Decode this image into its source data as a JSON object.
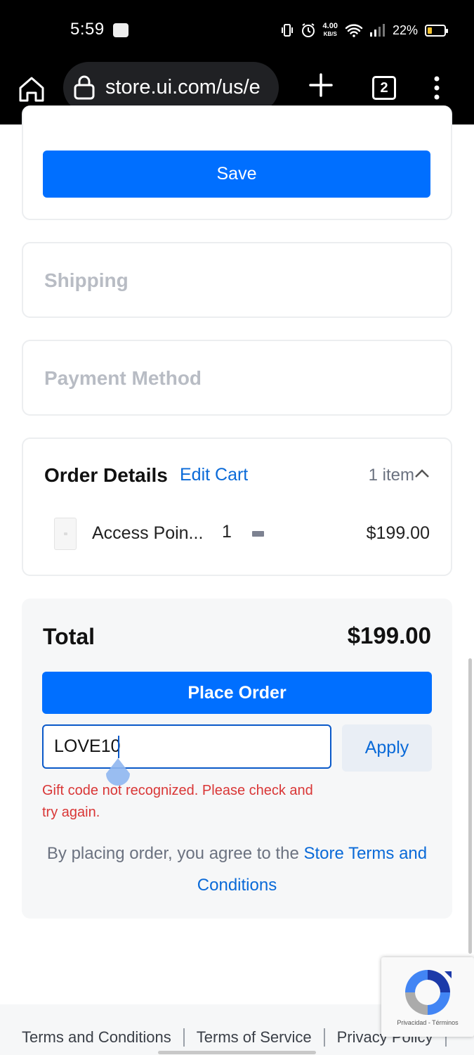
{
  "status_bar": {
    "time": "5:59",
    "net_speed_value": "4.00",
    "net_speed_unit": "KB/S",
    "battery": "22%"
  },
  "browser": {
    "url": "store.ui.com/us/e",
    "tab_count": "2"
  },
  "address_card": {
    "save_label": "Save"
  },
  "sections": {
    "shipping": "Shipping",
    "payment": "Payment Method"
  },
  "order_details": {
    "title": "Order Details",
    "edit_cart": "Edit Cart",
    "item_count": "1 item",
    "items": [
      {
        "name": "Access Poin...",
        "quantity": "1",
        "price": "$199.00"
      }
    ]
  },
  "summary": {
    "total_label": "Total",
    "total_value": "$199.00",
    "place_order": "Place Order",
    "gift_code_value": "LOVE10",
    "apply_label": "Apply",
    "gift_error": "Gift code not recognized. Please check and try again.",
    "terms_prefix": "By placing order, you agree to the ",
    "terms_link": "Store Terms and Conditions"
  },
  "recaptcha": {
    "text": "Privacidad - Términos"
  },
  "footer": {
    "links": [
      "Terms and Conditions",
      "Terms of Service",
      "Privacy Policy"
    ]
  },
  "colors": {
    "primary": "#006fff",
    "link": "#0a6ad8",
    "error": "#d93636"
  }
}
